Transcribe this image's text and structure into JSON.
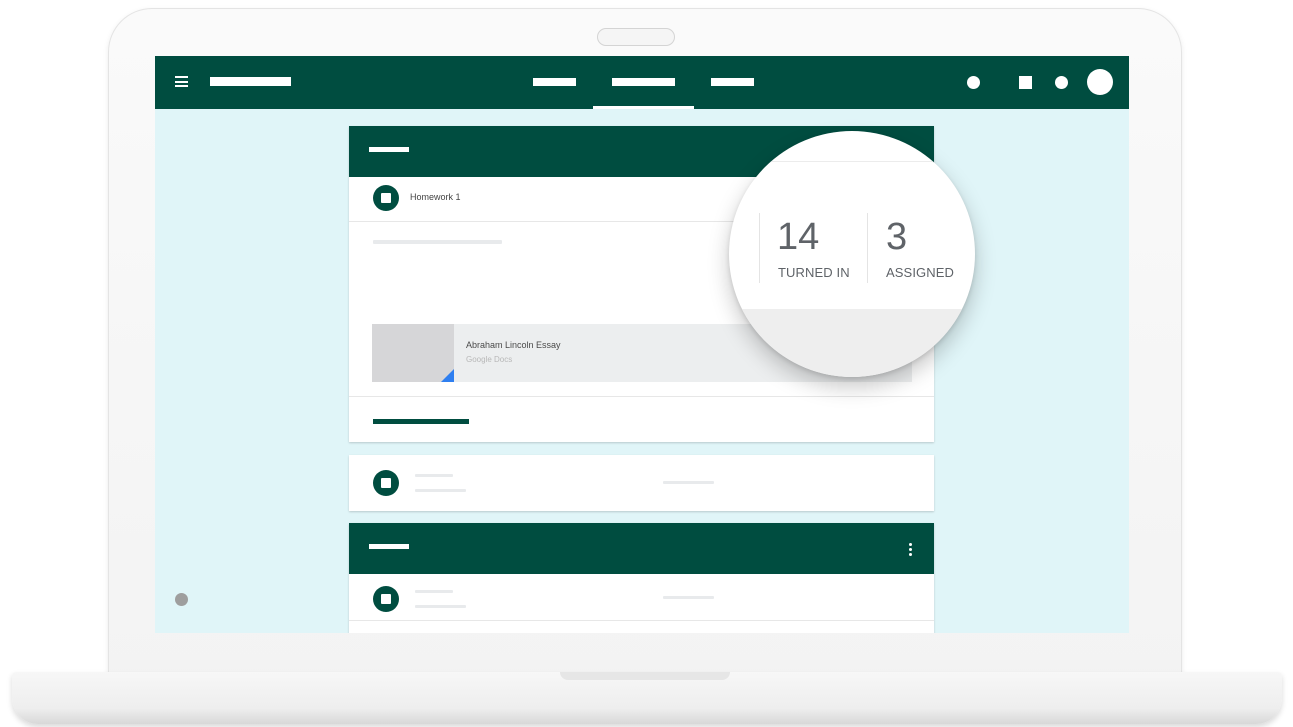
{
  "assignment": {
    "title": "Homework 1",
    "attachment": {
      "title": "Abraham Lincoln Essay",
      "type": "Google Docs"
    }
  },
  "stats": {
    "turned_in": {
      "value": "14",
      "label": "TURNED IN"
    },
    "assigned": {
      "value": "3",
      "label": "ASSIGNED"
    }
  },
  "icons": {
    "menu": "menu-icon",
    "more": "more-vert-icon",
    "assignment": "assignment-icon"
  },
  "colors": {
    "primary": "#004d40",
    "background": "#e0f5f8",
    "card": "#ffffff",
    "docs_blue": "#2f7ff0"
  }
}
